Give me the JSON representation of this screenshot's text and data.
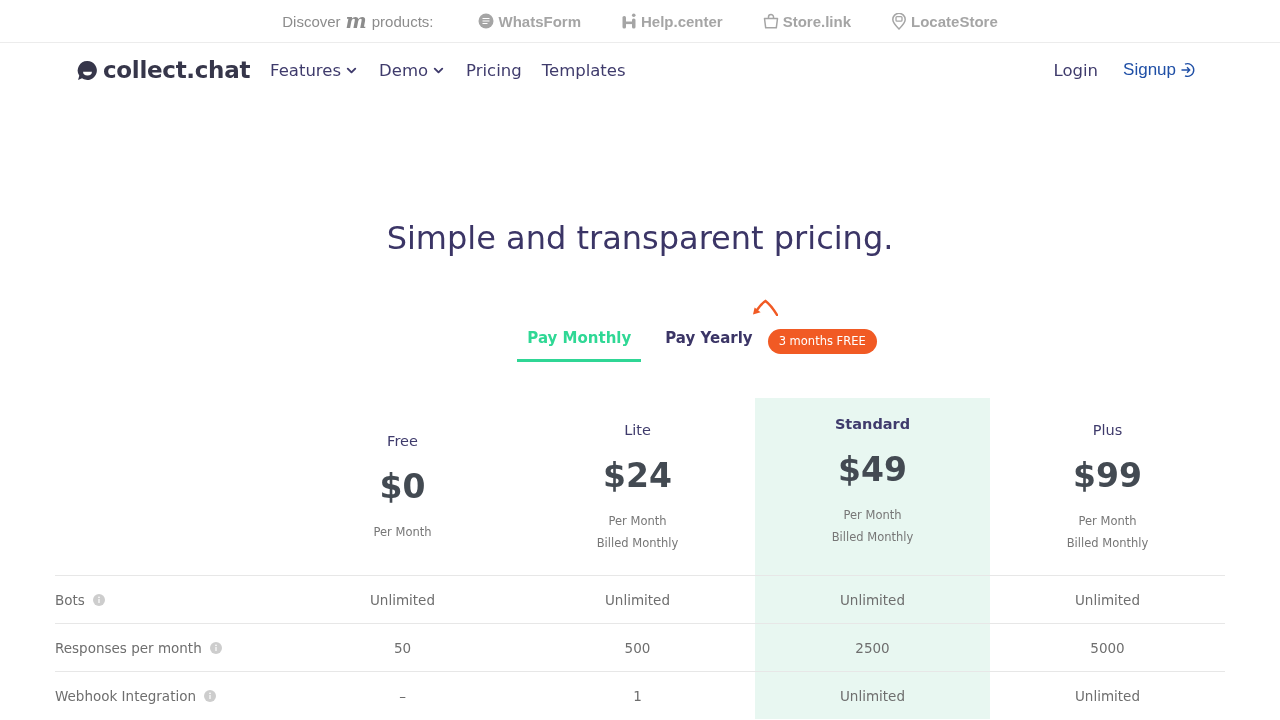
{
  "top_bar": {
    "discover_label": "Discover",
    "brand_mark": "m",
    "products_label": "products:",
    "products": [
      "WhatsForm",
      "Help.center",
      "Store.link",
      "LocateStore"
    ]
  },
  "nav": {
    "logo": "collect.chat",
    "links": [
      {
        "label": "Features",
        "dropdown": true
      },
      {
        "label": "Demo",
        "dropdown": true
      },
      {
        "label": "Pricing",
        "dropdown": false
      },
      {
        "label": "Templates",
        "dropdown": false
      }
    ],
    "login": "Login",
    "signup": "Signup"
  },
  "title": "Simple and transparent pricing.",
  "billing": {
    "tabs": [
      {
        "label": "Pay Monthly",
        "selected": true
      },
      {
        "label": "Pay Yearly",
        "selected": false
      }
    ],
    "badge": "3 months FREE"
  },
  "plans": [
    {
      "name": "Free",
      "price": "$0",
      "period": "Per Month",
      "highlighted": false
    },
    {
      "name": "Lite",
      "price": "$24",
      "period": "Per Month",
      "billing": "Billed Monthly",
      "highlighted": false
    },
    {
      "name": "Standard",
      "price": "$49",
      "period": "Per Month",
      "billing": "Billed Monthly",
      "highlighted": true
    },
    {
      "name": "Plus",
      "price": "$99",
      "period": "Per Month",
      "billing": "Billed Monthly",
      "highlighted": false
    }
  ],
  "features": [
    {
      "label": "Bots",
      "values": [
        "Unlimited",
        "Unlimited",
        "Unlimited",
        "Unlimited"
      ]
    },
    {
      "label": "Responses per month",
      "values": [
        "50",
        "500",
        "2500",
        "5000"
      ]
    },
    {
      "label": "Webhook Integration",
      "values": [
        "–",
        "1",
        "Unlimited",
        "Unlimited"
      ]
    }
  ]
}
